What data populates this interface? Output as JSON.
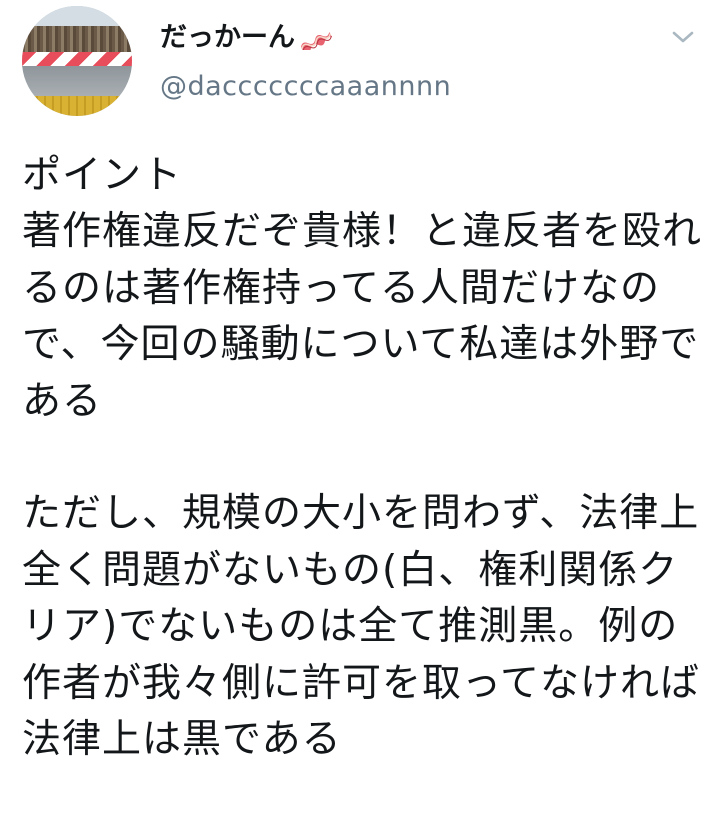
{
  "user": {
    "display_name": "だっかーん",
    "display_name_emoji": "bacon-icon",
    "username": "@dacccccccaaannnn"
  },
  "header": {
    "menu_icon": "chevron-down-icon"
  },
  "tweet": {
    "text": "ポイント\n著作権違反だぞ貴様！と違反者を殴れるのは著作権持ってる人間だけなので、今回の騒動について私達は外野である\n\nただし、規模の大小を問わず、法律上全く問題がないもの(白、権利関係クリア)でないものは全て推測黒。例の作者が我々側に許可を取ってなければ法律上は黒である"
  },
  "colors": {
    "text": "#14171a",
    "secondary": "#657786",
    "background": "#ffffff"
  }
}
